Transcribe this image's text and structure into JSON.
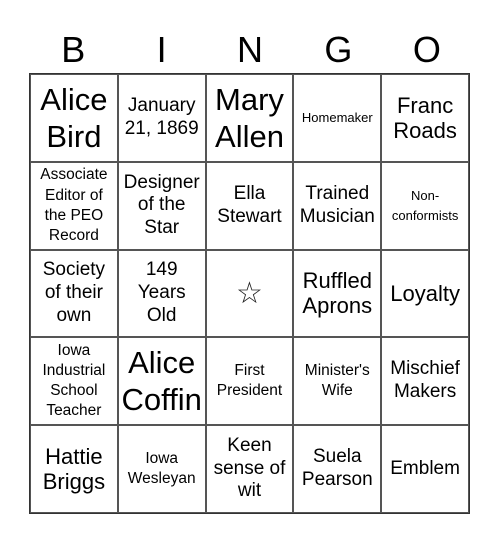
{
  "header": [
    "B",
    "I",
    "N",
    "G",
    "O"
  ],
  "cells": [
    [
      "Alice Bird",
      "January 21, 1869",
      "Mary Allen",
      "Homemaker",
      "Franc Roads"
    ],
    [
      "Associate Editor of the PEO Record",
      "Designer of the Star",
      "Ella Stewart",
      "Trained Musician",
      "Non-conformists"
    ],
    [
      "Society of their own",
      "149 Years Old",
      "☆",
      "Ruffled Aprons",
      "Loyalty"
    ],
    [
      "Iowa Industrial School Teacher",
      "Alice Coffin",
      "First President",
      "Minister's Wife",
      "Mischief Makers"
    ],
    [
      "Hattie Briggs",
      "Iowa Wesleyan",
      "Keen sense of wit",
      "Suela Pearson",
      "Emblem"
    ]
  ],
  "free_space_icon": "star-outline-icon"
}
